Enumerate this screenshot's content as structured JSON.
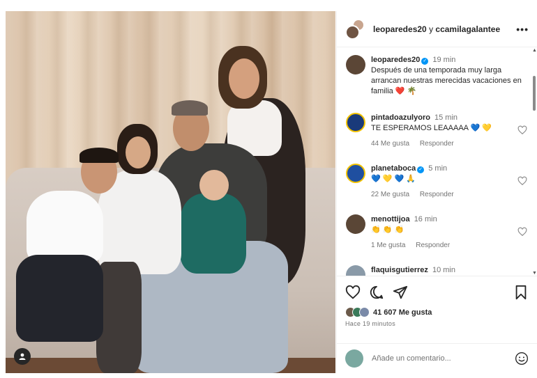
{
  "header": {
    "user1": "leoparedes20",
    "connector": "y",
    "user2": "ccamilagalantee",
    "more": "•••"
  },
  "caption": {
    "username": "leoparedes20",
    "verified": true,
    "time": "19 min",
    "text": "Después de una temporada muy larga arrancan nuestras merecidas vacaciones en familia ❤️ 🌴"
  },
  "comments": [
    {
      "username": "pintadoazulyoro",
      "verified": false,
      "time": "15 min",
      "text": "TE ESPERAMOS LEAAAAA 💙 💛",
      "likes": "44 Me gusta",
      "reply": "Responder",
      "avatar_color": "#1a3a7a"
    },
    {
      "username": "planetaboca",
      "verified": true,
      "time": "5 min",
      "text": "💙 💛 💙 🙏",
      "likes": "22 Me gusta",
      "reply": "Responder",
      "avatar_color": "#1f4fa0"
    },
    {
      "username": "menottijoa",
      "verified": false,
      "time": "16 min",
      "text": "👏 👏 👏",
      "likes": "1 Me gusta",
      "reply": "Responder",
      "avatar_color": "#5a4636"
    },
    {
      "username": "flaquisgutierrez",
      "verified": false,
      "time": "10 min",
      "text": "",
      "likes": "",
      "reply": "",
      "avatar_color": "#8a9aa8"
    }
  ],
  "actions": {
    "likes": "41 607 Me gusta",
    "posted": "Hace 19 minutos"
  },
  "add_comment": {
    "placeholder": "Añade un comentario..."
  },
  "colors": {
    "accent": "#0095f6",
    "text": "#262626",
    "muted": "#737373"
  }
}
